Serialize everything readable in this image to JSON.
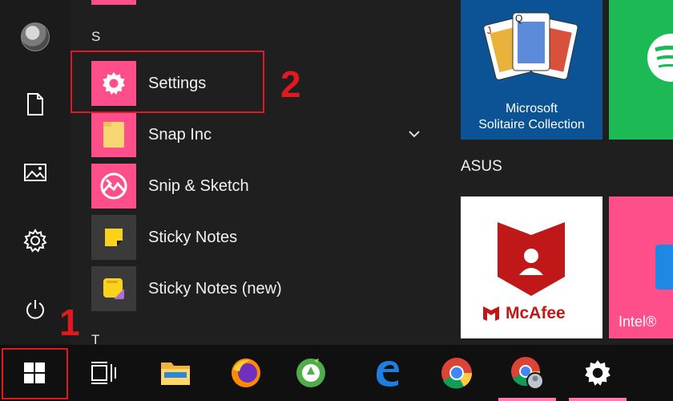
{
  "start_menu": {
    "rail": {
      "items": [
        "user-account",
        "documents",
        "pictures",
        "settings",
        "power"
      ]
    },
    "app_list": {
      "group_s": "S",
      "group_t": "T",
      "apps": [
        {
          "label": "Settings",
          "icon": "gear-icon",
          "tile_color": "#ff4f8b"
        },
        {
          "label": "Snap Inc",
          "icon": "folder-icon",
          "tile_color": "#ff4f8b",
          "expandable": true
        },
        {
          "label": "Snip & Sketch",
          "icon": "snip-sketch-icon",
          "tile_color": "#ff4f8b"
        },
        {
          "label": "Sticky Notes",
          "icon": "sticky-notes-icon",
          "tile_color": "#3a3a3a"
        },
        {
          "label": "Sticky Notes (new)",
          "icon": "sticky-notes-new-icon",
          "tile_color": "#3a3a3a"
        }
      ]
    },
    "tiles": {
      "solitaire": {
        "line1": "Microsoft",
        "line2": "Solitaire Collection",
        "color": "#0b5394"
      },
      "spotify_color": "#1db954",
      "group_title": "ASUS",
      "mcafee": {
        "brand": "McAfee",
        "color": "#ffffff"
      },
      "intel": {
        "label": "Intel®",
        "color": "#ff4f8b"
      }
    }
  },
  "annotations": {
    "step1": "1",
    "step2": "2",
    "color": "#e0181f"
  },
  "taskbar": {
    "items": [
      "start",
      "task-view",
      "file-explorer",
      "firefox",
      "coccoc",
      "edge",
      "chrome",
      "chrome-profile",
      "settings"
    ],
    "accent": "#ff7ab0"
  }
}
